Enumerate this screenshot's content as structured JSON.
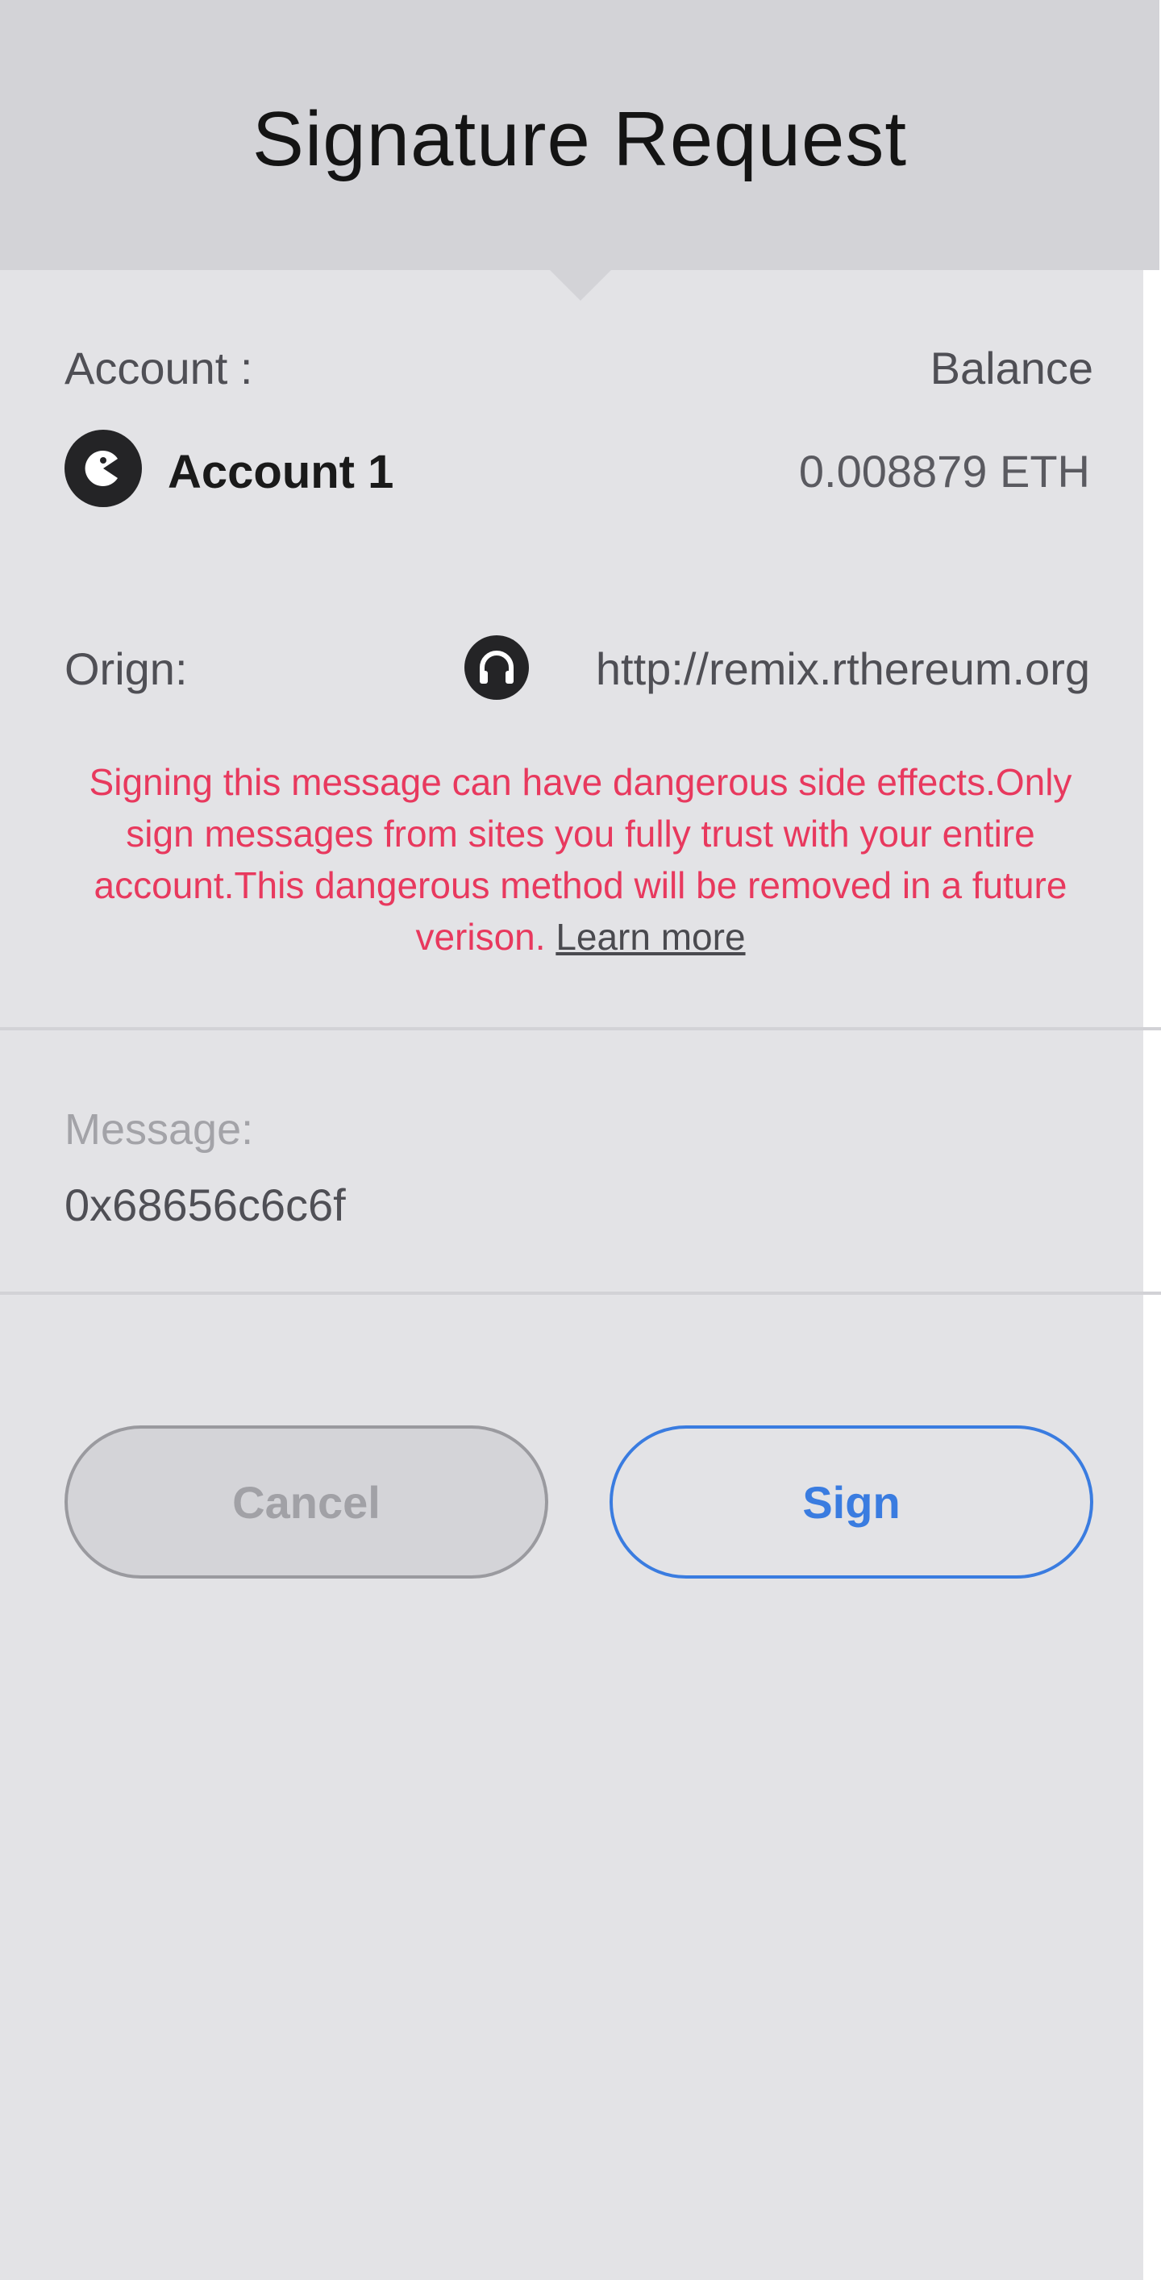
{
  "header": {
    "title": "Signature Request"
  },
  "account": {
    "label": "Account :",
    "name": "Account 1",
    "avatar_icon": "pacman-avatar-icon"
  },
  "balance": {
    "label": "Balance",
    "value": "0.008879 ETH"
  },
  "origin": {
    "label": "Orign:",
    "icon": "headphones-icon",
    "url": "http://remix.rthereum.org"
  },
  "warning": {
    "text": "Signing this message can have dangerous side effects.Only sign messages from sites you fully trust with your entire account.This dangerous method will be removed in a future verison.",
    "link_label": "Learn more",
    "color": "#e8395e"
  },
  "message": {
    "label": "Message:",
    "value": "0x68656c6c6f"
  },
  "actions": {
    "cancel_label": "Cancel",
    "sign_label": "Sign",
    "accent_color": "#3a7ce0"
  }
}
